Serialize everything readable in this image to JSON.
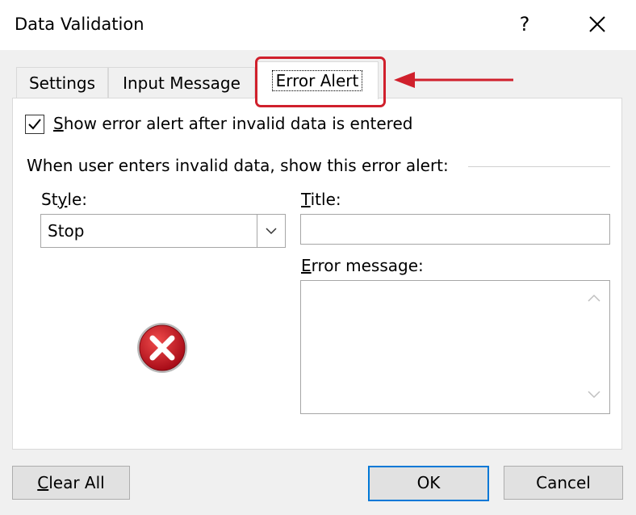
{
  "window": {
    "title": "Data Validation",
    "help_label": "?",
    "close_icon": "close-icon"
  },
  "tabs": [
    {
      "label": "Settings",
      "selected": false
    },
    {
      "label": "Input Message",
      "selected": false
    },
    {
      "label": "Error Alert",
      "selected": true
    }
  ],
  "annotation": {
    "highlight_color": "#d0202c",
    "arrow_icon": "arrow-left-icon"
  },
  "error_alert": {
    "show_alert_checkbox": {
      "label_first": "S",
      "label_rest": "how error alert after invalid data is entered",
      "checked": true
    },
    "group_label": "When user enters invalid data, show this error alert:",
    "style": {
      "label_first": "St",
      "label_underline": "y",
      "label_rest": "le:",
      "value": "Stop",
      "icon": "stop-error-icon"
    },
    "title_field": {
      "label_first": "T",
      "label_rest": "itle:",
      "value": ""
    },
    "message_field": {
      "label_first": "E",
      "label_rest": "rror message:",
      "value": ""
    }
  },
  "buttons": {
    "clear_all_first": "C",
    "clear_all_rest": "lear All",
    "ok": "OK",
    "cancel": "Cancel"
  },
  "colors": {
    "ok_border": "#0078d7",
    "stop_red": "#c8102e"
  }
}
